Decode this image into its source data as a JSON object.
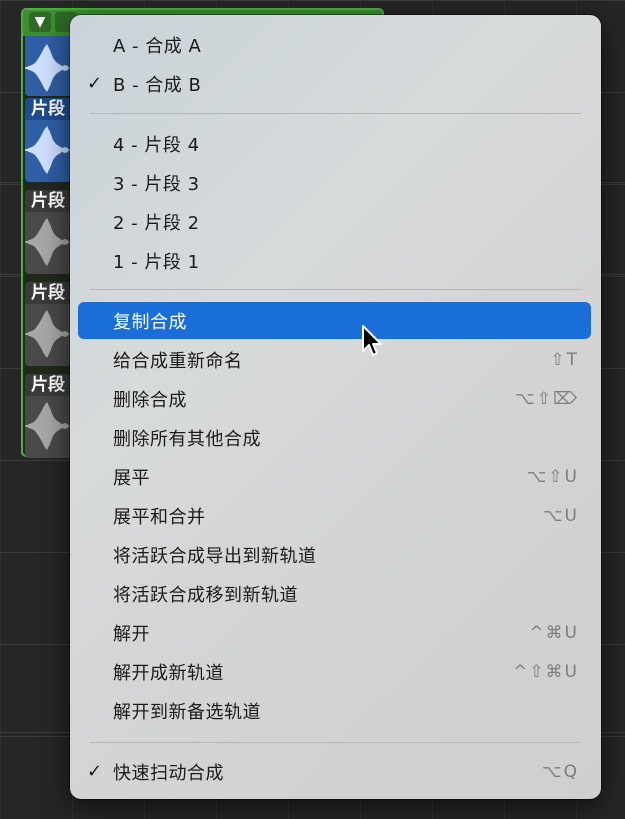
{
  "region": {
    "takes": [
      {
        "label": "片段",
        "wave_color": "blue"
      },
      {
        "label": "片段",
        "wave_color": "blue"
      },
      {
        "label": "片段",
        "wave_color": "gray"
      },
      {
        "label": "片段",
        "wave_color": "gray"
      },
      {
        "label": "片段",
        "wave_color": "gray"
      }
    ],
    "collapse_icon": "▼"
  },
  "menu": {
    "comp_items": [
      {
        "label": "A - 合成 A",
        "checked": false
      },
      {
        "label": "B - 合成 B",
        "checked": true
      }
    ],
    "take_items": [
      {
        "label": "4 - 片段 4"
      },
      {
        "label": "3 - 片段 3"
      },
      {
        "label": "2 - 片段 2"
      },
      {
        "label": "1 - 片段 1"
      }
    ],
    "action_items": [
      {
        "label": "复制合成",
        "shortcut": "",
        "highlighted": true
      },
      {
        "label": "给合成重新命名",
        "shortcut": "⇧T"
      },
      {
        "label": "删除合成",
        "shortcut": "⌥⇧⌦"
      },
      {
        "label": "删除所有其他合成",
        "shortcut": ""
      },
      {
        "label": "展平",
        "shortcut": "⌥⇧U"
      },
      {
        "label": "展平和合并",
        "shortcut": "⌥U"
      },
      {
        "label": "将活跃合成导出到新轨道",
        "shortcut": ""
      },
      {
        "label": "将活跃合成移到新轨道",
        "shortcut": ""
      },
      {
        "label": "解开",
        "shortcut": "^⌘U"
      },
      {
        "label": "解开成新轨道",
        "shortcut": "^⇧⌘U"
      },
      {
        "label": "解开到新备选轨道",
        "shortcut": ""
      }
    ],
    "bottom_item": {
      "label": "快速扫动合成",
      "shortcut": "⌥Q",
      "checked": true
    },
    "check_glyph": "✓"
  },
  "colors": {
    "highlight": "#1a6ed8",
    "region_border": "#4caf3f",
    "take_blue": "#2f5fa6",
    "take_gray": "#4a4a4a"
  }
}
